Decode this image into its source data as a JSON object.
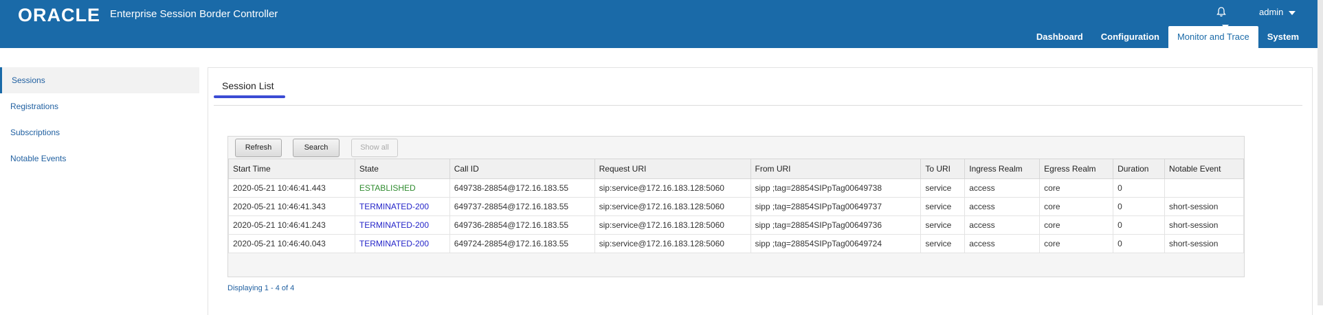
{
  "header": {
    "logo": "ORACLE",
    "product": "Enterprise Session Border Controller",
    "user": "admin",
    "nav": [
      "Dashboard",
      "Configuration",
      "Monitor and Trace",
      "System"
    ],
    "active_nav": "Monitor and Trace"
  },
  "sidebar": {
    "items": [
      {
        "label": "Sessions"
      },
      {
        "label": "Registrations"
      },
      {
        "label": "Subscriptions"
      },
      {
        "label": "Notable Events"
      }
    ]
  },
  "main": {
    "title": "Session List",
    "toolbar": {
      "refresh": "Refresh",
      "search": "Search",
      "show_all": "Show all"
    },
    "columns": [
      "Start Time",
      "State",
      "Call ID",
      "Request URI",
      "From URI",
      "To URI",
      "Ingress Realm",
      "Egress Realm",
      "Duration",
      "Notable Event"
    ],
    "rows": [
      [
        "2020-05-21 10:46:41.443",
        "ESTABLISHED",
        "649738-28854@172.16.183.55",
        "sip:service@172.16.183.128:5060",
        "sipp ;tag=28854SIPpTag00649738",
        "service",
        "access",
        "core",
        "0",
        ""
      ],
      [
        "2020-05-21 10:46:41.343",
        "TERMINATED-200",
        "649737-28854@172.16.183.55",
        "sip:service@172.16.183.128:5060",
        "sipp ;tag=28854SIPpTag00649737",
        "service",
        "access",
        "core",
        "0",
        "short-session"
      ],
      [
        "2020-05-21 10:46:41.243",
        "TERMINATED-200",
        "649736-28854@172.16.183.55",
        "sip:service@172.16.183.128:5060",
        "sipp ;tag=28854SIPpTag00649736",
        "service",
        "access",
        "core",
        "0",
        "short-session"
      ],
      [
        "2020-05-21 10:46:40.043",
        "TERMINATED-200",
        "649724-28854@172.16.183.55",
        "sip:service@172.16.183.128:5060",
        "sipp ;tag=28854SIPpTag00649724",
        "service",
        "access",
        "core",
        "0",
        "short-session"
      ]
    ],
    "footer": "Displaying 1 - 4 of 4"
  },
  "colors": {
    "brand": "#1a6aa8",
    "state_established": "#2e8b2e",
    "state_terminated": "#2323c8",
    "link": "#1f5fa0"
  }
}
